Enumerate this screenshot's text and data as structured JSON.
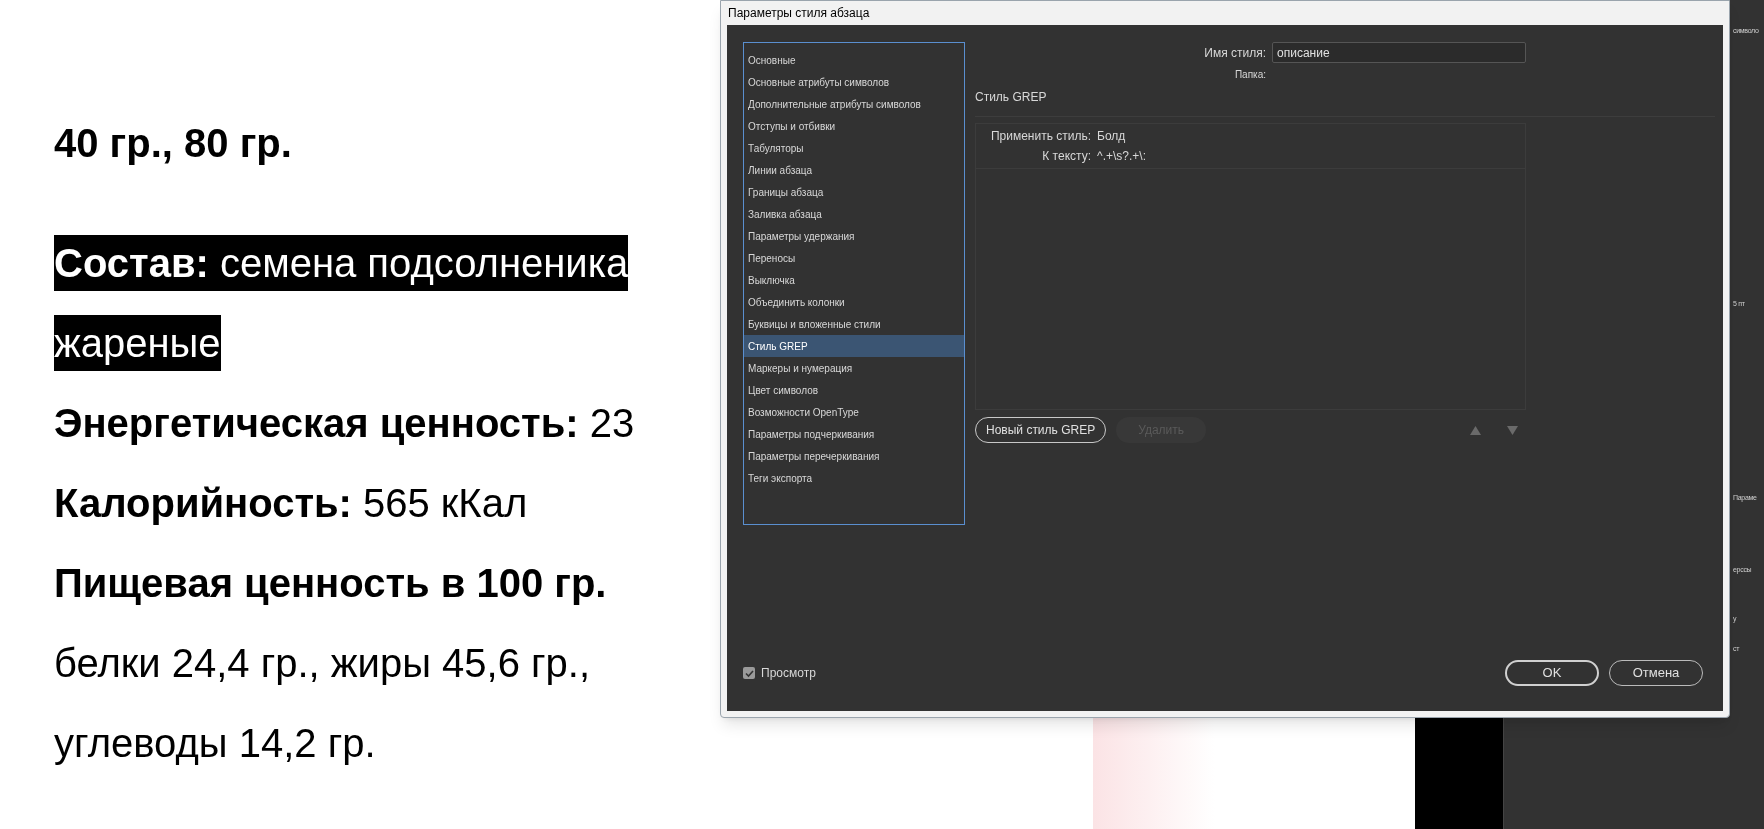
{
  "document": {
    "lines": [
      {
        "text": "40 гр., 80 гр.",
        "bold": true,
        "highlighted": false
      },
      {
        "text": "**Состав:** семена подсолненика",
        "bold": false,
        "highlighted": true
      },
      {
        "text": "жареные",
        "bold": false,
        "highlighted": true
      },
      {
        "text": "**Энергетическая ценность:** 23",
        "bold": false,
        "highlighted": false
      },
      {
        "text": "**Калорийность:** 565 кКал",
        "bold": false,
        "highlighted": false
      },
      {
        "text": "Пищевая ценность в 100 гр.",
        "bold": true,
        "highlighted": false
      },
      {
        "text": "белки 24,4 гр., жиры 45,6 гр.,",
        "bold": false,
        "highlighted": false
      },
      {
        "text": "углеводы 14,2 гр.",
        "bold": false,
        "highlighted": false
      }
    ]
  },
  "side_panel": {
    "texts": [
      "символо",
      "5 пт",
      "Параме",
      "ерссы",
      "у",
      "ст"
    ]
  },
  "dialog": {
    "title": "Параметры стиля абзаца",
    "categories": [
      {
        "label": "Основные",
        "selected": false
      },
      {
        "label": "Основные атрибуты символов",
        "selected": false
      },
      {
        "label": "Дополнительные атрибуты символов",
        "selected": false
      },
      {
        "label": "Отступы и отбивки",
        "selected": false
      },
      {
        "label": "Табуляторы",
        "selected": false
      },
      {
        "label": "Линии абзаца",
        "selected": false
      },
      {
        "label": "Границы абзаца",
        "selected": false
      },
      {
        "label": "Заливка абзаца",
        "selected": false
      },
      {
        "label": "Параметры удержания",
        "selected": false
      },
      {
        "label": "Переносы",
        "selected": false
      },
      {
        "label": "Выключка",
        "selected": false
      },
      {
        "label": "Объединить колонки",
        "selected": false
      },
      {
        "label": "Буквицы и вложенные стили",
        "selected": false
      },
      {
        "label": "Стиль GREP",
        "selected": true
      },
      {
        "label": "Маркеры и нумерация",
        "selected": false
      },
      {
        "label": "Цвет символов",
        "selected": false
      },
      {
        "label": "Возможности OpenType",
        "selected": false
      },
      {
        "label": "Параметры подчеркивания",
        "selected": false
      },
      {
        "label": "Параметры перечеркивания",
        "selected": false
      },
      {
        "label": "Теги экспорта",
        "selected": false
      }
    ],
    "style_name": {
      "label": "Имя стиля:",
      "value": "описание"
    },
    "folder_label": "Папка:",
    "section_title": "Стиль GREP",
    "grep_rules": [
      {
        "apply_label": "Применить стиль:",
        "apply_value": "Болд",
        "to_label": "К тексту:",
        "to_value": "^.+\\s?.+\\:"
      }
    ],
    "buttons": [
      {
        "label": "Новый стиль GREP",
        "disabled": false
      },
      {
        "label": "Удалить",
        "disabled": true
      }
    ],
    "preview": {
      "label": "Просмотр",
      "checked": true
    },
    "ok": "OK",
    "cancel": "Отмена"
  }
}
